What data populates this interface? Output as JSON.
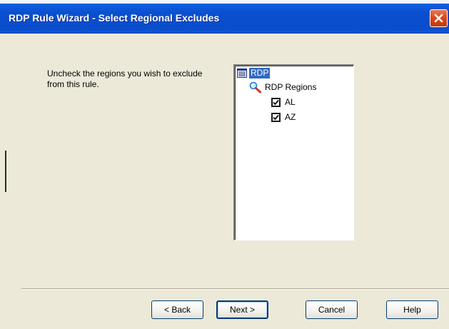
{
  "window": {
    "title": "RDP Rule Wizard - Select Regional Excludes",
    "close_icon": "close-icon",
    "background_color": "#ECE9D8",
    "titlebar_color": "#0A4DCB",
    "close_color": "#D7461C"
  },
  "instruction": {
    "text": "Uncheck the regions you wish to exclude from this rule."
  },
  "tree": {
    "root": {
      "label": "RDP",
      "icon": "list-view-icon",
      "selected": true
    },
    "group": {
      "label": "RDP Regions",
      "icon": "magnifier-icon"
    },
    "items": [
      {
        "label": "AL",
        "checked": true
      },
      {
        "label": "AZ",
        "checked": true
      }
    ],
    "selection_color": "#316AC5"
  },
  "buttons": {
    "back": "< Back",
    "next": "Next >",
    "cancel": "Cancel",
    "help": "Help"
  }
}
